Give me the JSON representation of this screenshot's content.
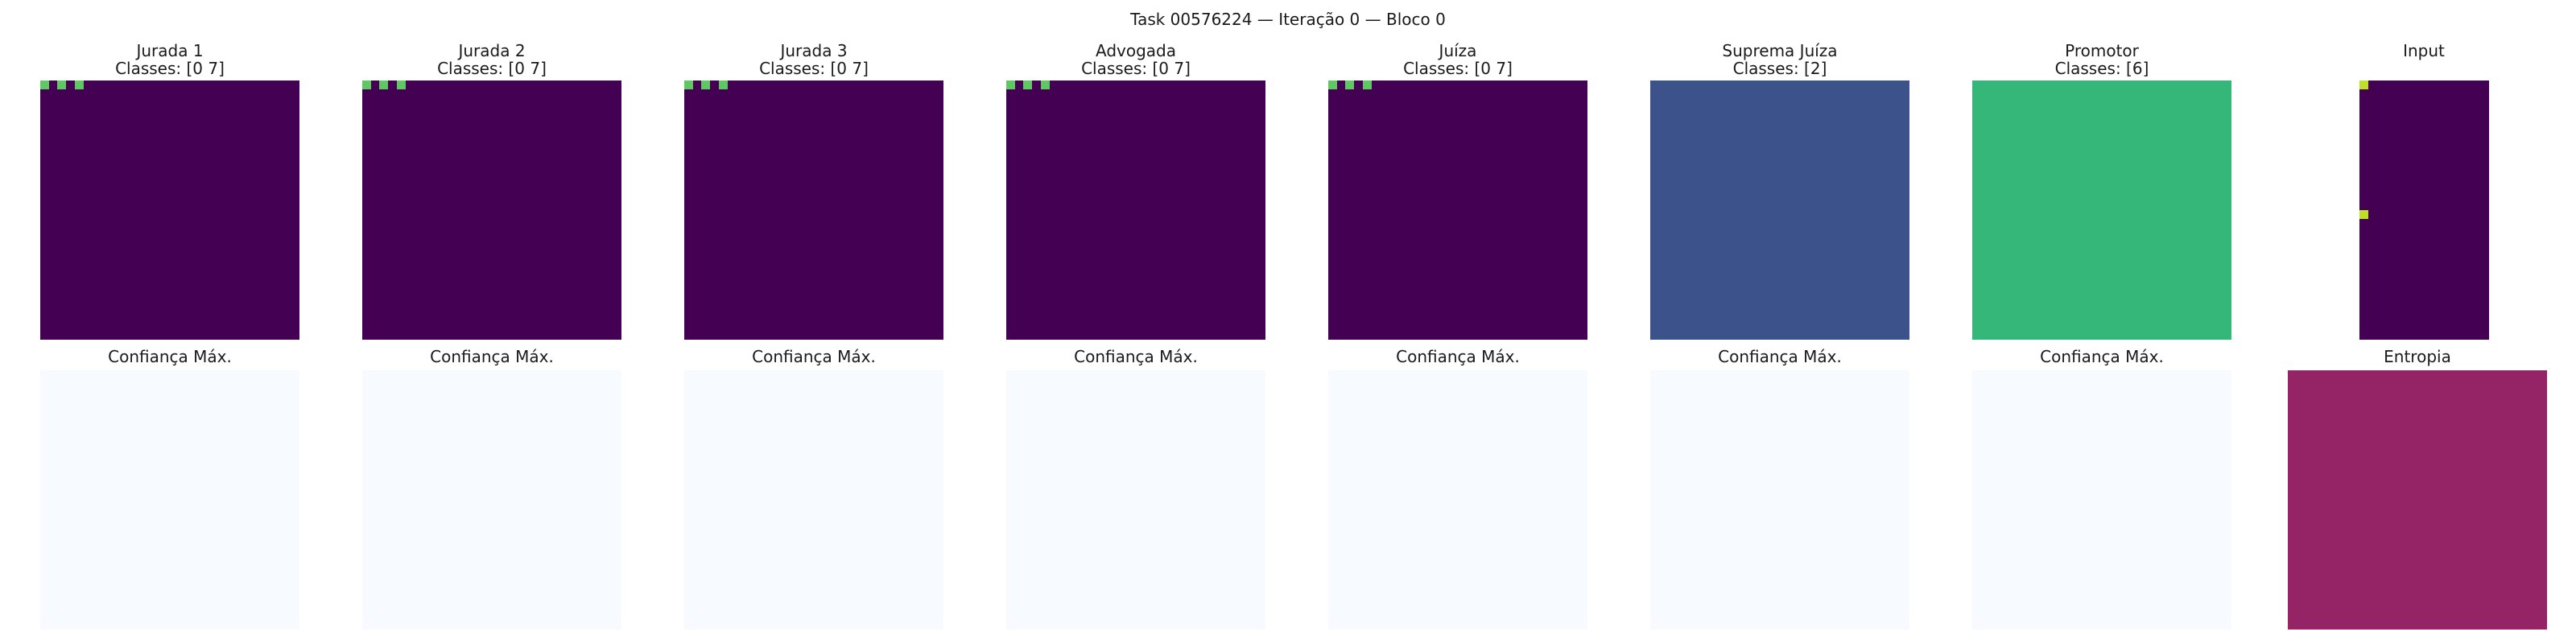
{
  "figure": {
    "title": "Task 00576224 — Iteração 0 — Bloco 0"
  },
  "chart_data": [
    {
      "type": "heatmap",
      "role": "top",
      "title": "Jurada 1",
      "subtitle": "Classes: [0 7]",
      "rows": 30,
      "cols": 30,
      "background": "#440154",
      "marks": [
        {
          "row": 0,
          "col": 0,
          "color": "#5ec962"
        },
        {
          "row": 0,
          "col": 2,
          "color": "#5ec962"
        },
        {
          "row": 0,
          "col": 4,
          "color": "#5ec962"
        }
      ]
    },
    {
      "type": "heatmap",
      "role": "top",
      "title": "Jurada 2",
      "subtitle": "Classes: [0 7]",
      "rows": 30,
      "cols": 30,
      "background": "#440154",
      "marks": [
        {
          "row": 0,
          "col": 0,
          "color": "#5ec962"
        },
        {
          "row": 0,
          "col": 2,
          "color": "#5ec962"
        },
        {
          "row": 0,
          "col": 4,
          "color": "#5ec962"
        }
      ]
    },
    {
      "type": "heatmap",
      "role": "top",
      "title": "Jurada 3",
      "subtitle": "Classes: [0 7]",
      "rows": 30,
      "cols": 30,
      "background": "#440154",
      "marks": [
        {
          "row": 0,
          "col": 0,
          "color": "#5ec962"
        },
        {
          "row": 0,
          "col": 2,
          "color": "#5ec962"
        },
        {
          "row": 0,
          "col": 4,
          "color": "#5ec962"
        }
      ]
    },
    {
      "type": "heatmap",
      "role": "top",
      "title": "Advogada",
      "subtitle": "Classes: [0 7]",
      "rows": 30,
      "cols": 30,
      "background": "#440154",
      "marks": [
        {
          "row": 0,
          "col": 0,
          "color": "#5ec962"
        },
        {
          "row": 0,
          "col": 2,
          "color": "#5ec962"
        },
        {
          "row": 0,
          "col": 4,
          "color": "#5ec962"
        }
      ]
    },
    {
      "type": "heatmap",
      "role": "top",
      "title": "Juíza",
      "subtitle": "Classes: [0 7]",
      "rows": 30,
      "cols": 30,
      "background": "#440154",
      "marks": [
        {
          "row": 0,
          "col": 0,
          "color": "#5ec962"
        },
        {
          "row": 0,
          "col": 2,
          "color": "#5ec962"
        },
        {
          "row": 0,
          "col": 4,
          "color": "#5ec962"
        }
      ]
    },
    {
      "type": "heatmap",
      "role": "top",
      "title": "Suprema Juíza",
      "subtitle": "Classes: [2]",
      "rows": 30,
      "cols": 30,
      "background": "#3b528b",
      "marks": []
    },
    {
      "type": "heatmap",
      "role": "top",
      "title": "Promotor",
      "subtitle": "Classes: [6]",
      "rows": 30,
      "cols": 30,
      "background": "#35b779",
      "marks": []
    },
    {
      "type": "heatmap",
      "role": "top",
      "title": "Input",
      "subtitle": "",
      "rows": 30,
      "cols": 15,
      "background": "#440154",
      "marks": [
        {
          "row": 0,
          "col": 0,
          "color": "#bddf26"
        },
        {
          "row": 15,
          "col": 0,
          "color": "#bddf26"
        }
      ]
    },
    {
      "type": "heatmap",
      "role": "bottom",
      "title": "Confiança Máx.",
      "rows": 30,
      "cols": 30,
      "background": "#f7fbff",
      "marks": []
    },
    {
      "type": "heatmap",
      "role": "bottom",
      "title": "Confiança Máx.",
      "rows": 30,
      "cols": 30,
      "background": "#f7fbff",
      "marks": []
    },
    {
      "type": "heatmap",
      "role": "bottom",
      "title": "Confiança Máx.",
      "rows": 30,
      "cols": 30,
      "background": "#f7fbff",
      "marks": []
    },
    {
      "type": "heatmap",
      "role": "bottom",
      "title": "Confiança Máx.",
      "rows": 30,
      "cols": 30,
      "background": "#f7fbff",
      "marks": []
    },
    {
      "type": "heatmap",
      "role": "bottom",
      "title": "Confiança Máx.",
      "rows": 30,
      "cols": 30,
      "background": "#f7fbff",
      "marks": []
    },
    {
      "type": "heatmap",
      "role": "bottom",
      "title": "Confiança Máx.",
      "rows": 30,
      "cols": 30,
      "background": "#f7fbff",
      "marks": []
    },
    {
      "type": "heatmap",
      "role": "bottom",
      "title": "Confiança Máx.",
      "rows": 30,
      "cols": 30,
      "background": "#f7fbff",
      "marks": []
    },
    {
      "type": "heatmap",
      "role": "bottom",
      "title": "Entropia",
      "rows": 30,
      "cols": 30,
      "background": "#942466",
      "marks": []
    }
  ]
}
